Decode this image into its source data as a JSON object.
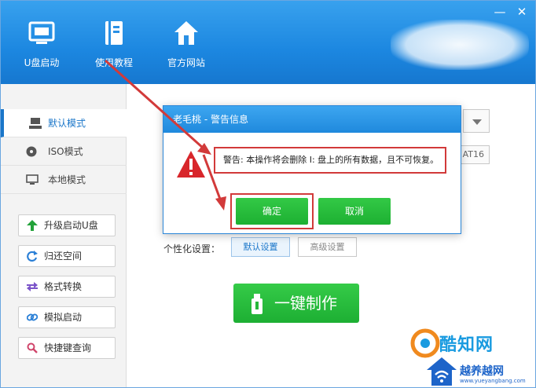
{
  "header": {
    "nav": [
      {
        "label": "U盘启动",
        "icon": "usb-monitor-icon"
      },
      {
        "label": "使用教程",
        "icon": "book-icon"
      },
      {
        "label": "官方网站",
        "icon": "home-icon"
      }
    ],
    "minimize_label": "—",
    "close_label": "✕"
  },
  "sidebar": {
    "modes": [
      {
        "label": "默认模式",
        "icon": "computer-icon",
        "active": true
      },
      {
        "label": "ISO模式",
        "icon": "disc-icon",
        "active": false
      },
      {
        "label": "本地模式",
        "icon": "monitor-icon",
        "active": false
      }
    ],
    "tools": [
      {
        "label": "升级启动U盘",
        "icon": "arrow-up-icon"
      },
      {
        "label": "归还空间",
        "icon": "refresh-icon"
      },
      {
        "label": "格式转换",
        "icon": "swap-icon"
      },
      {
        "label": "模拟启动",
        "icon": "link-icon"
      },
      {
        "label": "快捷键查询",
        "icon": "search-icon"
      }
    ]
  },
  "main": {
    "filesystem_partial": "AT16",
    "personal_label": "个性化设置：",
    "default_settings": "默认设置",
    "advanced_settings": "高级设置",
    "make_button": "一键制作"
  },
  "dialog": {
    "title": "老毛桃 - 警告信息",
    "warning": "警告: 本操作将会删除 I: 盘上的所有数据，且不可恢复。",
    "ok": "确定",
    "cancel": "取消"
  },
  "watermark": {
    "brand1": "酷知网",
    "brand2": "越养越网",
    "url": "www.yueyangbang.com"
  },
  "colors": {
    "header_blue": "#1c87e0",
    "accent_green": "#1daf33",
    "annotation_red": "#d23a3a"
  }
}
